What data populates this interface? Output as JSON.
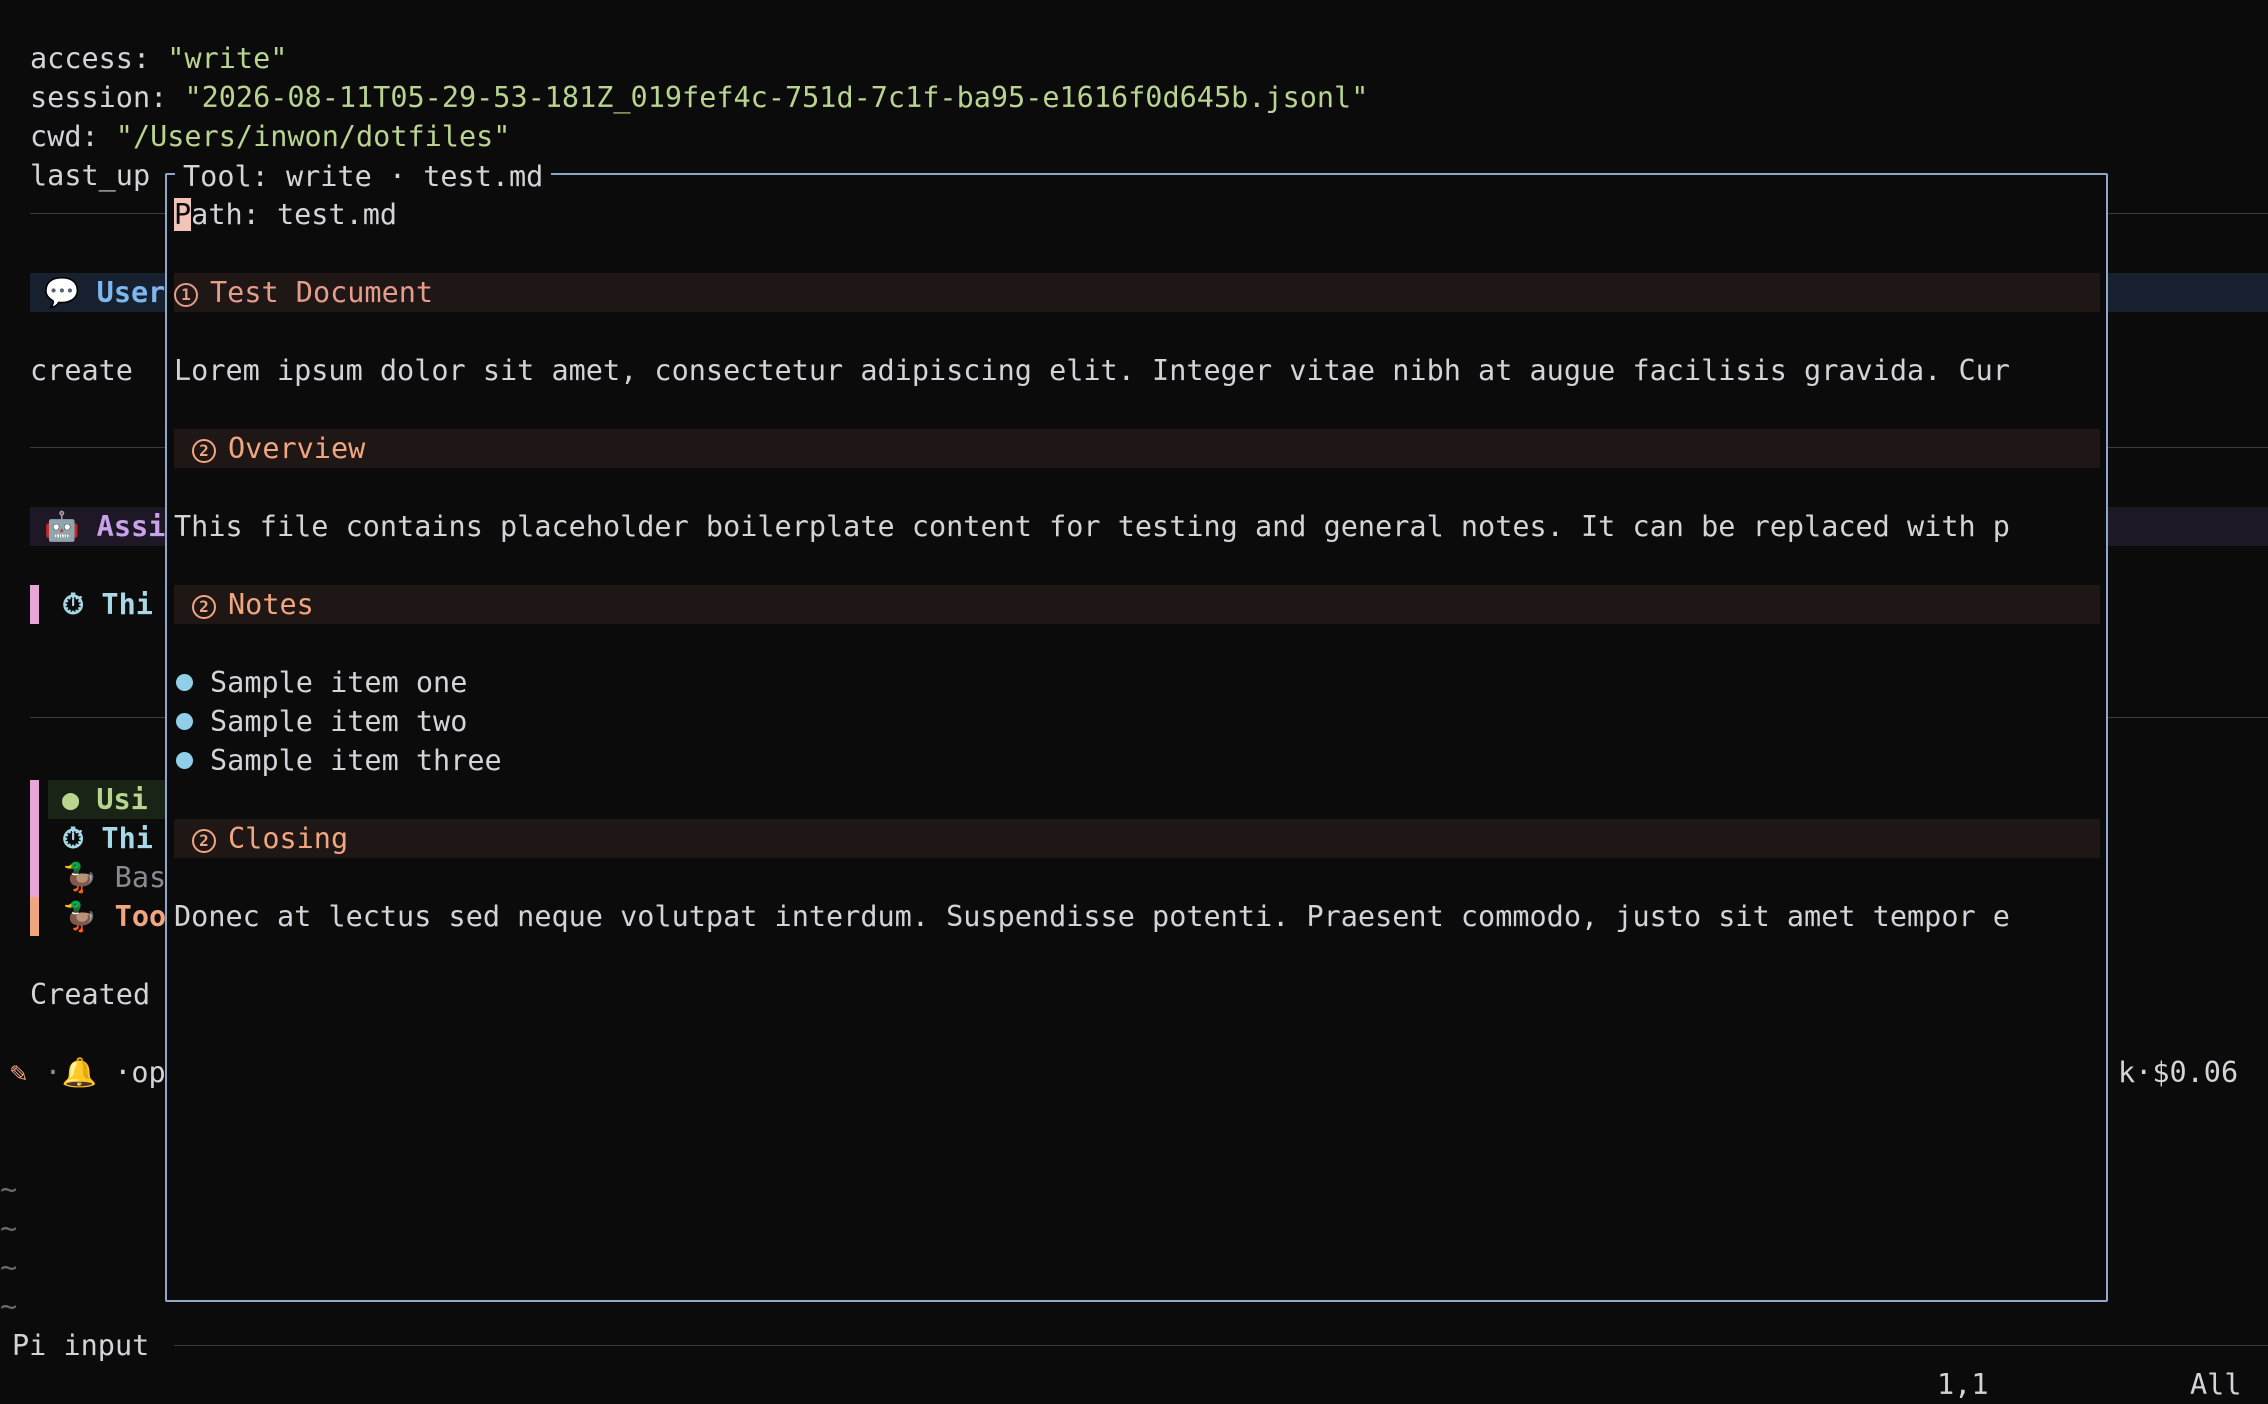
{
  "header": {
    "access_key": "access: ",
    "access_val": "\"write\"",
    "session_key": "session: ",
    "session_val": "\"2026-08-11T05-29-53-181Z_019fef4c-751d-7c1f-ba95-e1616f0d645b.jsonl\"",
    "cwd_key": "cwd: ",
    "cwd_val": "\"/Users/inwon/dotfiles\"",
    "last_up": "last_up"
  },
  "background": {
    "user_label": "User",
    "create_text": "create",
    "assistant_label": "Assi",
    "thinking1": "Thi",
    "using_label": "Usi",
    "thinking2": "Thi",
    "bash_label": "Bas",
    "tool_label": "Too",
    "created_text": "Created",
    "footer_left": "·op",
    "footer_right": "k·$0.06"
  },
  "popup": {
    "title": "Tool: write · test.md",
    "path_cursor_char": "P",
    "path_rest": "ath: test.md",
    "sections": {
      "h1_num": "1",
      "h1_title": "Test Document",
      "p1": "Lorem ipsum dolor sit amet, consectetur adipiscing elit. Integer vitae nibh at augue facilisis gravida. Cur",
      "h2a_num": "2",
      "h2a_title": "Overview",
      "p2": "This file contains placeholder boilerplate content for testing and general notes. It can be replaced with p",
      "h2b_num": "2",
      "h2b_title": "Notes",
      "items": [
        "Sample item one",
        "Sample item two",
        "Sample item three"
      ],
      "h2c_num": "2",
      "h2c_title": "Closing",
      "p3": "Donec at lectus sed neque volutpat interdum. Suspendisse potenti. Praesent commodo, justo sit amet tempor e"
    }
  },
  "statusline": {
    "mode": "Pi input",
    "position": "1,1",
    "scroll": "All"
  },
  "colors": {
    "accent_user": "#7eb6f0",
    "accent_assistant": "#c9a3ea",
    "thinking": "#a8d8e8",
    "using": "#b9d48e",
    "tool": "#f0a67e",
    "popup_border": "#8fa8c8",
    "heading": "#e59c8a"
  }
}
